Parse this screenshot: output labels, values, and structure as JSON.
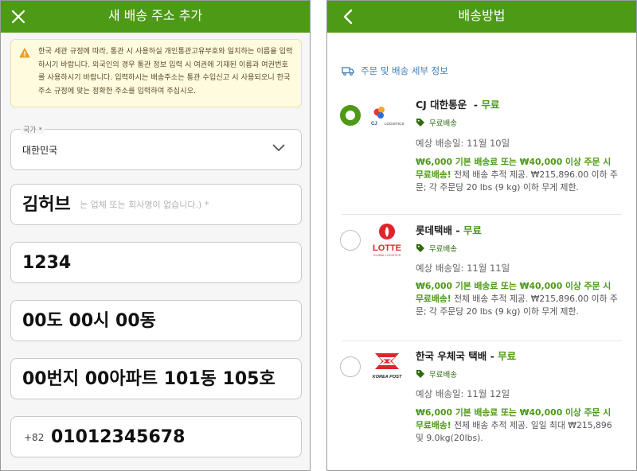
{
  "left": {
    "header": {
      "title": "새 배송 주소 추가",
      "close_icon": "close-icon"
    },
    "notice": {
      "icon": "warning-icon",
      "text": "한국 세관 규정에 따라, 통관 시 사용하실 개인통관고유부호와 일치하는 이름을 입력하시기 바랍니다. 외국인의 경우 통관 정보 입력 시 여권에 기재된 이름과 여권번호를 사용하시기 바랍니다. 입력하시는 배송주소는 통관 수입신고 시 사용되오니 한국 주소 규정에 맞는 정확한 주소를 입력하여 주십시오."
    },
    "country": {
      "label": "국가 *",
      "value": "대한민국"
    },
    "name_field": {
      "value": "김허브",
      "placeholder": "는 업체 또는 회사명이 없습니다.) *"
    },
    "postal_field": {
      "value": "1234"
    },
    "address1_field": {
      "value": "00도 00시 00동"
    },
    "address2_field": {
      "value": "00번지 00아파트  101동 105호"
    },
    "phone_field": {
      "prefix": "+82",
      "value": "01012345678"
    }
  },
  "right": {
    "header": {
      "title": "배송방법",
      "back_icon": "back-arrow-icon"
    },
    "detail_link": "주문 및 배송 세부 정보",
    "options": [
      {
        "carrier": "CJ 대한통운",
        "price_sep": "  - ",
        "price": "무료",
        "tag": "무료배송",
        "eta": "예상 배송일: 11월 10일",
        "highlight": "₩6,000 기본 배송료 또는 ₩40,000 이상 주문 시 무료배송!",
        "detail": " 전체 배송 추적 제공. ₩215,896.00 이하 주문; 각 주문당 20 lbs (9 kg) 이하 무게 제한.",
        "selected": true,
        "logo_text": "LOGISTICS"
      },
      {
        "carrier": "롯데택배",
        "price_sep": " - ",
        "price": "무료",
        "tag": "무료배송",
        "eta": "예상 배송일: 11월 11일",
        "highlight": "₩6,000 기본 배송료 또는 ₩40,000 이상 주문 시 무료배송!",
        "detail": " 전체 배송 추적 제공. ₩215,896.00 이하 주문; 각 주문당 20 lbs (9 kg) 이하 무게 제한.",
        "selected": false,
        "logo_text": "LOTTE",
        "logo_sub": "GLOBAL LOGISTICS"
      },
      {
        "carrier": "한국 우체국 택배",
        "price_sep": " - ",
        "price": "무료",
        "tag": "무료배송",
        "eta": "예상 배송일: 11월 12일",
        "highlight": "₩6,000 기본 배송료 또는 ₩40,000 이상 주문 시 무료배송!",
        "detail": " 전체 배송 추적 제공. 일일 최대 ₩215,896 및 9.0kg(20lbs).",
        "selected": false,
        "logo_text": "KOREA POST"
      }
    ]
  },
  "colors": {
    "brand_green": "#4d9a16",
    "notice_bg": "#fffbdf",
    "link_blue": "#3f7fb7"
  }
}
